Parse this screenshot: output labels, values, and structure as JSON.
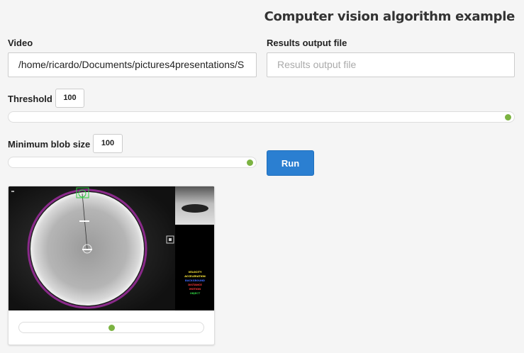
{
  "header": {
    "title": "Computer vision algorithm example"
  },
  "video": {
    "label": "Video",
    "value": "/home/ricardo/Documents/pictures4presentations/S"
  },
  "results": {
    "label": "Results output file",
    "placeholder": "Results output file"
  },
  "threshold": {
    "label": "Threshold",
    "value": "100",
    "level": 1.0
  },
  "min_blob": {
    "label": "Minimum blob size",
    "value": "100",
    "level": 1.0
  },
  "run": {
    "label": "Run"
  },
  "player": {
    "position": 0.5,
    "overlay_lines": [
      "VELOCITY",
      "ACCELERATION",
      "BACKGROUND",
      "DISTANCE",
      "MOTION",
      "OBJECT"
    ],
    "colors": {
      "accent": "#7cb342",
      "button": "#2b7fd1",
      "dish_ring": "#8a2a8a"
    }
  }
}
